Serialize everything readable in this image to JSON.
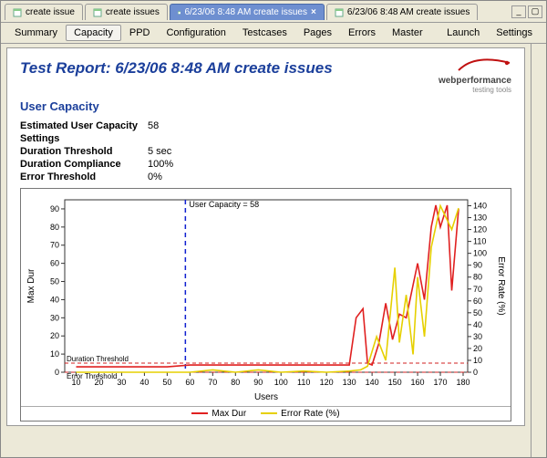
{
  "doc_tabs": [
    {
      "label": "create issue",
      "active": false
    },
    {
      "label": "create issues",
      "active": false
    },
    {
      "label": "6/23/06 8:48 AM create issues",
      "active": true,
      "closeable": true
    },
    {
      "label": "6/23/06 8:48 AM create issues",
      "active": false
    }
  ],
  "sys_buttons": {
    "min": "_",
    "max": "▢"
  },
  "toolbar": {
    "tabs": [
      "Summary",
      "Capacity",
      "PPD",
      "Configuration",
      "Testcases",
      "Pages",
      "Errors",
      "Master"
    ],
    "active": "Capacity",
    "right": [
      "Launch",
      "Settings"
    ]
  },
  "report": {
    "title": "Test Report: 6/23/06 8:48 AM create issues",
    "logo_main": "webperformance",
    "logo_sub": "testing tools"
  },
  "section": {
    "title": "User Capacity",
    "kv": [
      {
        "k": "Estimated User Capacity",
        "v": "58"
      },
      {
        "k": "Settings",
        "v": ""
      },
      {
        "k": "Duration Threshold",
        "v": "5 sec"
      },
      {
        "k": "Duration Compliance",
        "v": "100%"
      },
      {
        "k": "Error Threshold",
        "v": "0%"
      }
    ]
  },
  "chart_data": {
    "type": "line",
    "xlabel": "Users",
    "ylabel_left": "Max Dur",
    "ylabel_right": "Error Rate (%)",
    "x_ticks": [
      10,
      20,
      30,
      40,
      50,
      60,
      70,
      80,
      90,
      100,
      110,
      120,
      130,
      140,
      150,
      160,
      170,
      180
    ],
    "y_left_ticks": [
      0,
      10,
      20,
      30,
      40,
      50,
      60,
      70,
      80,
      90
    ],
    "y_right_ticks": [
      0,
      10,
      20,
      30,
      40,
      50,
      60,
      70,
      80,
      90,
      100,
      110,
      120,
      130,
      140
    ],
    "xlim": [
      5,
      182
    ],
    "ylim_left": [
      0,
      95
    ],
    "ylim_right": [
      0,
      145
    ],
    "user_capacity_line": {
      "x": 58,
      "label": "User Capacity = 58",
      "color": "#1020d0"
    },
    "duration_threshold": {
      "y_left": 5,
      "label": "Duration Threshold",
      "color": "#d02020"
    },
    "error_threshold": {
      "y_right": 0,
      "label": "Error Threshold",
      "color": "#d02020"
    },
    "series": [
      {
        "name": "Max Dur",
        "axis": "left",
        "color": "#e02020",
        "x": [
          10,
          20,
          30,
          40,
          50,
          60,
          70,
          80,
          90,
          100,
          110,
          120,
          130,
          133,
          136,
          138,
          140,
          143,
          146,
          149,
          152,
          155,
          158,
          160,
          163,
          166,
          168,
          170,
          173,
          175,
          178
        ],
        "values": [
          3,
          3,
          3,
          3,
          3,
          4,
          4,
          4,
          4,
          4,
          4,
          4,
          4,
          30,
          35,
          5,
          4,
          16,
          38,
          18,
          32,
          30,
          48,
          60,
          40,
          80,
          92,
          80,
          92,
          45,
          90
        ]
      },
      {
        "name": "Error Rate (%)",
        "axis": "right",
        "color": "#e6d000",
        "x": [
          10,
          20,
          30,
          40,
          50,
          60,
          70,
          80,
          90,
          100,
          110,
          120,
          130,
          135,
          138,
          142,
          146,
          150,
          152,
          155,
          158,
          160,
          163,
          166,
          170,
          175,
          178
        ],
        "values": [
          0,
          0,
          0,
          0,
          0,
          0,
          2,
          0,
          2,
          0,
          1,
          0,
          1,
          2,
          5,
          30,
          10,
          88,
          25,
          65,
          15,
          80,
          30,
          105,
          140,
          120,
          138
        ]
      }
    ],
    "legend": [
      "Max Dur",
      "Error Rate (%)"
    ]
  }
}
